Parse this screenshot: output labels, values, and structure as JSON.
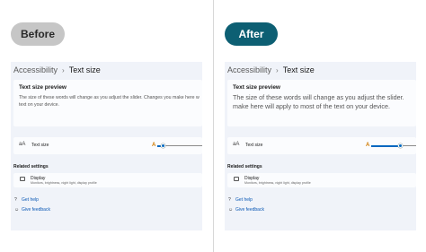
{
  "labels": {
    "before": "Before",
    "after": "After"
  },
  "settings": {
    "breadcrumb_parent": "Accessibility",
    "breadcrumb_current": "Text size",
    "preview_title": "Text size preview",
    "preview_text_line1_before": "The size of these words will change as you adjust the slider. Changes you make here w",
    "preview_text_line2_before": "text on your device.",
    "preview_text_line1_after": "The size of these words will change as you adjust the slider.",
    "preview_text_line2_after": "make here will apply to most of the text on your device.",
    "textsize_label": "Text size",
    "related_heading": "Related settings",
    "display_title": "Display",
    "display_subtitle": "Monitors, brightness, night light, display profile",
    "get_help": "Get help",
    "give_feedback": "Give feedback"
  },
  "slider": {
    "before_level": 0.13,
    "after_level": 0.65
  },
  "icons": {
    "text-size": "aA",
    "slider-a": "A",
    "display": "monitor",
    "help": "question-icon",
    "feedback": "feedback-icon"
  },
  "colors": {
    "accent": "#0067c0",
    "after_pill": "#0d5f73",
    "before_pill": "#c6c6c6",
    "link": "#0a58b5"
  }
}
